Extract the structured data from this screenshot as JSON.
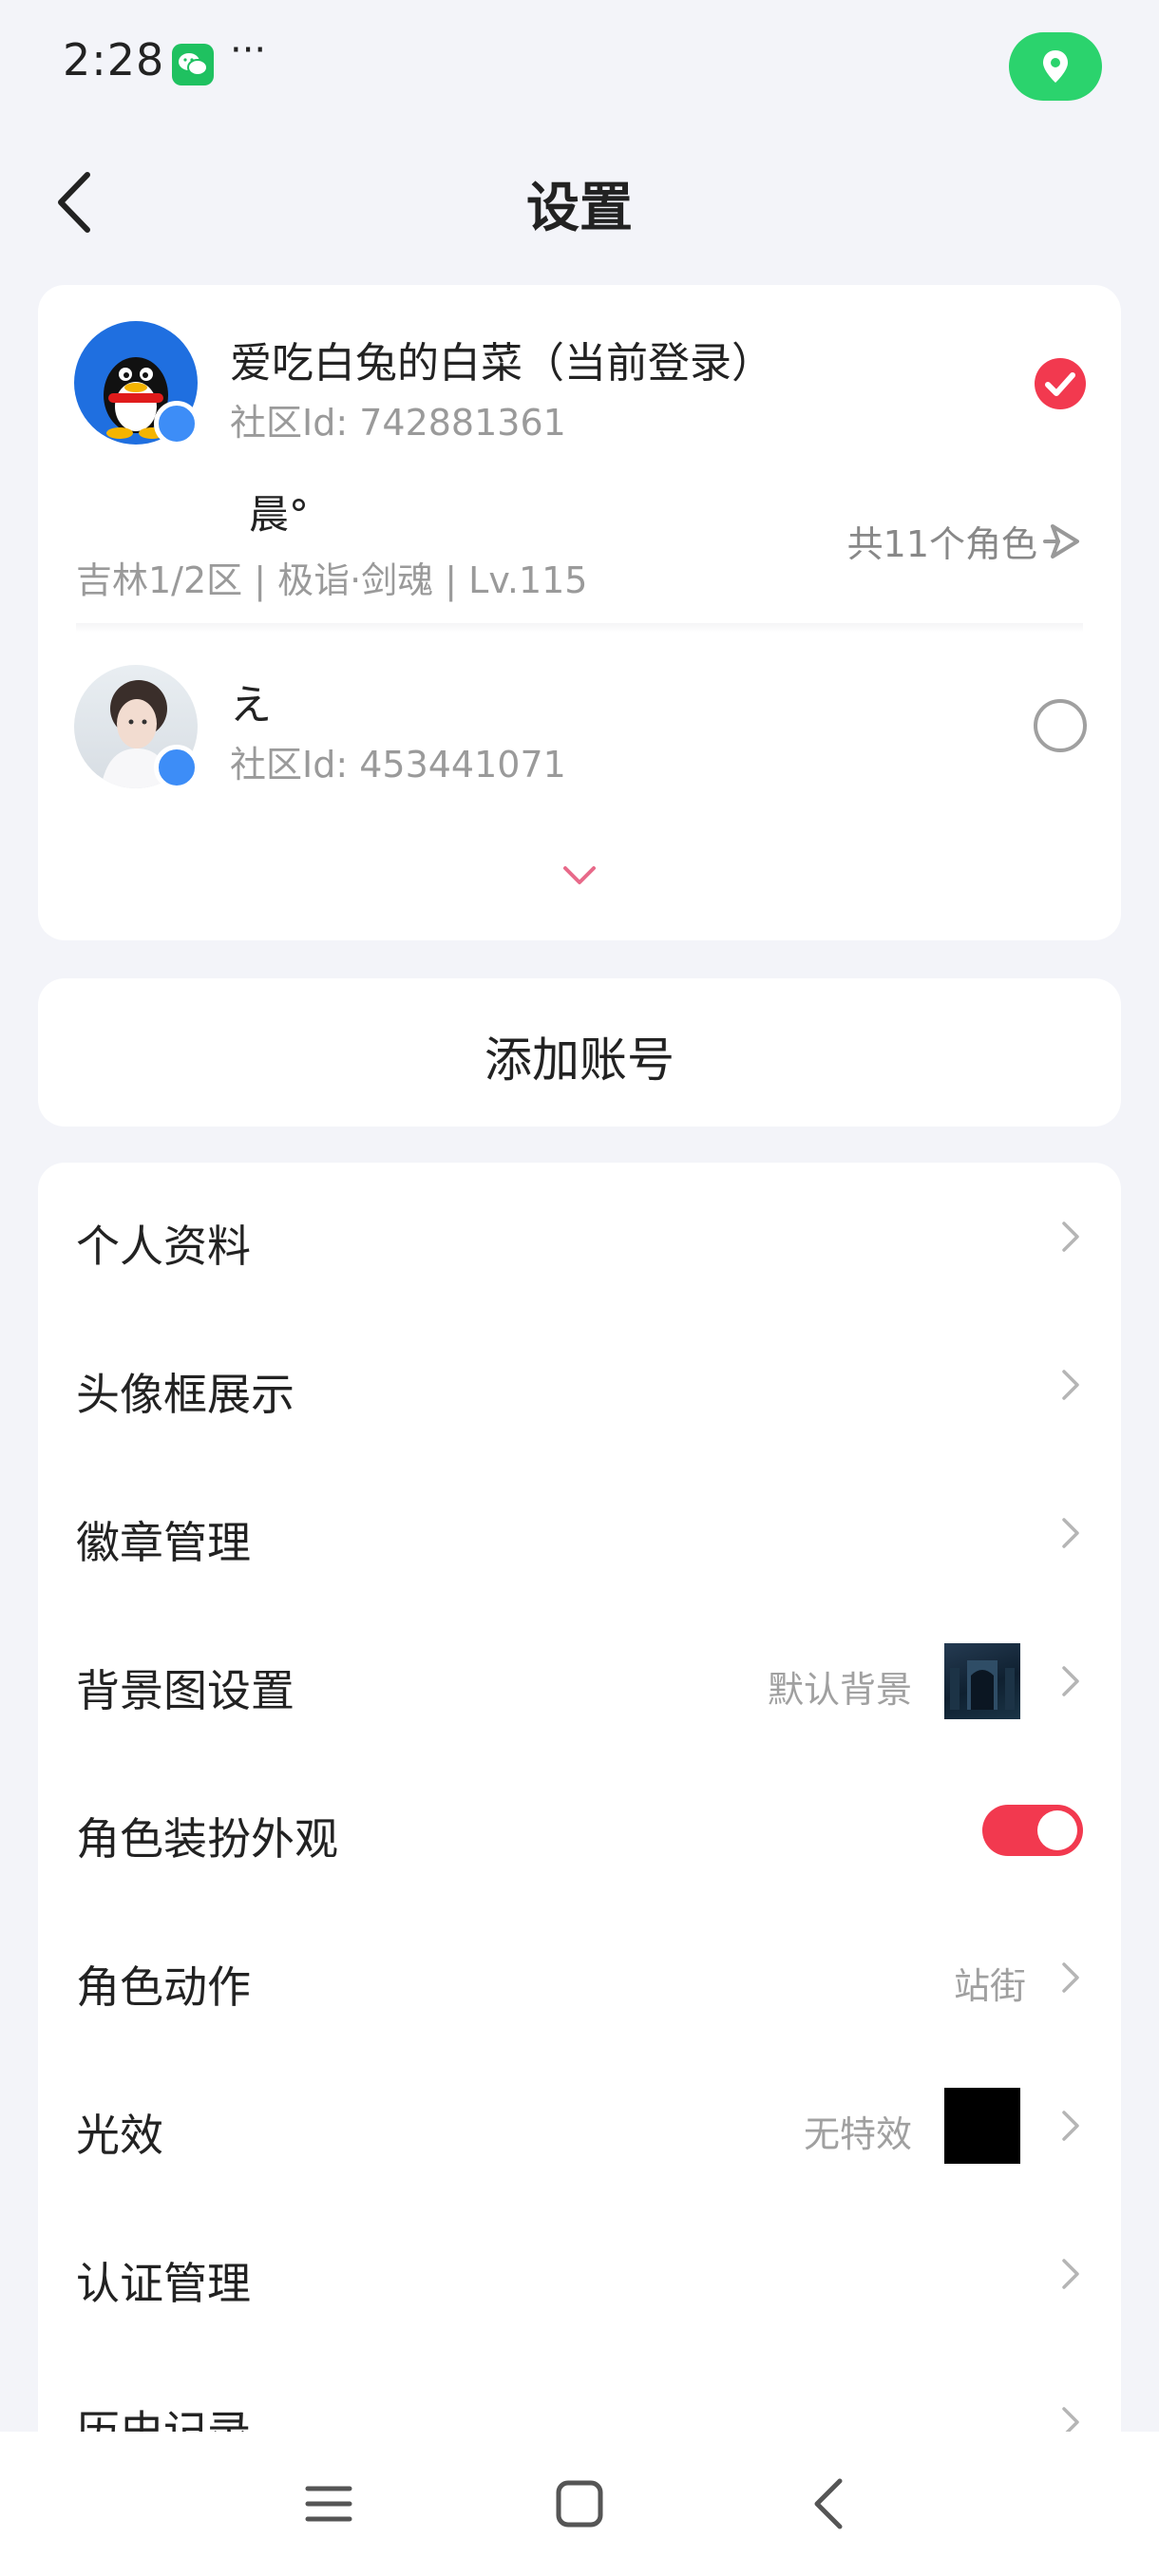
{
  "status_bar": {
    "time": "2:28",
    "dots": "···",
    "icons": [
      "wechat-icon",
      "location-icon"
    ],
    "location_color": "#2bd36d"
  },
  "header": {
    "title": "设置",
    "back_icon": "chevron-left-icon"
  },
  "accounts": {
    "items": [
      {
        "name": "爱吃白兔的白菜（当前登录）",
        "id_label": "社区Id: 742881361",
        "selected": true,
        "avatar_icon": "qq-penguin-avatar"
      },
      {
        "name": "え",
        "id_label": "社区Id: 453441071",
        "selected": false,
        "avatar_icon": "photo-avatar"
      }
    ],
    "role": {
      "name": "晨°",
      "server": "吉林1/2区 | 极诣·剑魂 | Lv.115",
      "count": "共11个角色"
    },
    "accent_color": "#f2394f"
  },
  "add_account": {
    "label": "添加账号"
  },
  "settings": {
    "rows": [
      {
        "label": "个人资料"
      },
      {
        "label": "头像框展示"
      },
      {
        "label": "徽章管理"
      },
      {
        "label": "背景图设置",
        "value": "默认背景"
      },
      {
        "label": "角色装扮外观",
        "toggle": true
      },
      {
        "label": "角色动作",
        "value": "站街"
      },
      {
        "label": "光效",
        "value": "无特效"
      },
      {
        "label": "认证管理"
      },
      {
        "label": "历史记录"
      }
    ]
  },
  "nav_bar": {
    "icons": [
      "menu-icon",
      "home-icon",
      "back-icon"
    ]
  }
}
